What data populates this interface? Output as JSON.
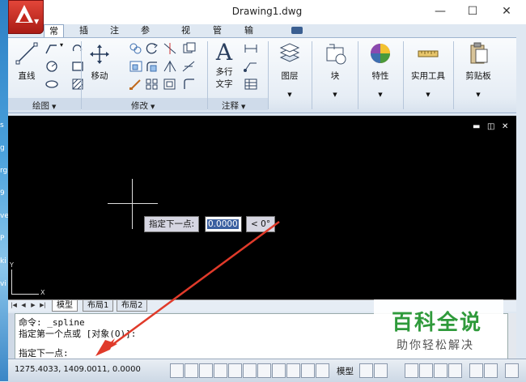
{
  "window": {
    "title": "Drawing1.dwg",
    "minimize": "—",
    "maximize": "☐",
    "close": "✕"
  },
  "desktop_strip": [
    "s",
    "g",
    "rg",
    "9",
    "ve",
    "P",
    "ki",
    "vi"
  ],
  "tabs": [
    {
      "label": "常用",
      "active": true
    },
    {
      "label": "插入",
      "active": false
    },
    {
      "label": "注释",
      "active": false
    },
    {
      "label": "参数化",
      "active": false
    },
    {
      "label": "视图",
      "active": false
    },
    {
      "label": "管理",
      "active": false
    },
    {
      "label": "输出",
      "active": false
    }
  ],
  "ribbon": {
    "draw": {
      "title": "绘图",
      "line_label": "直线"
    },
    "modify": {
      "title": "修改",
      "move_label": "移动"
    },
    "annotate": {
      "title": "注释",
      "mtext_label_1": "多行",
      "mtext_label_2": "文字"
    },
    "layers": {
      "label": "图层"
    },
    "block": {
      "label": "块"
    },
    "properties": {
      "label": "特性"
    },
    "utilities": {
      "label": "实用工具"
    },
    "clipboard": {
      "label": "剪贴板"
    }
  },
  "canvas": {
    "controls": [
      "▬",
      "◫",
      "✕"
    ],
    "ucs_x": "X",
    "ucs_y": "Y",
    "dynamic_prompt": "指定下一点:",
    "input_value": "0.0000",
    "angle_value": "< 0°"
  },
  "layout_tabs": [
    {
      "label": "模型",
      "active": true
    },
    {
      "label": "布局1",
      "active": false
    },
    {
      "label": "布局2",
      "active": false
    }
  ],
  "command": {
    "lines": [
      "命令:  _spline",
      "指定第一个点或 [对象(O)]:",
      "指定下一点:"
    ]
  },
  "watermark": {
    "main": "百科全说",
    "sub": "助你轻松解决"
  },
  "status": {
    "coords": "1275.4033,  1409.0011, 0.0000",
    "model_label": "模型"
  },
  "colors": {
    "accent_red": "#c3261c",
    "arrow": "#e03a2a",
    "watermark_green": "#2f9a3b"
  }
}
